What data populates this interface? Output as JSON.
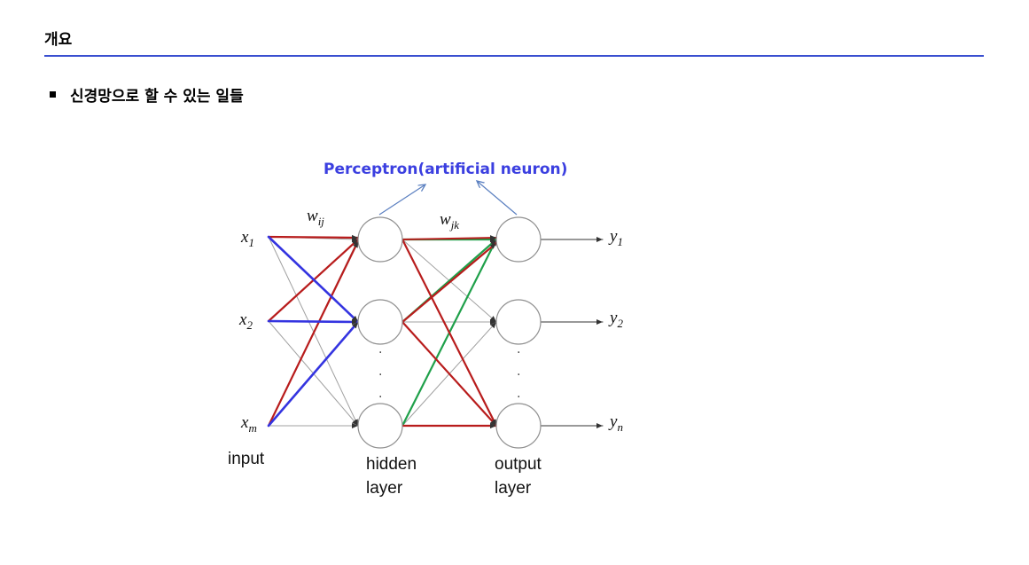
{
  "header": {
    "title": "개요"
  },
  "bullet": {
    "text": "신경망으로 할 수 있는 일들"
  },
  "diagram": {
    "callout": "Perceptron(artificial neuron)",
    "weights": {
      "w_ij": {
        "base": "w",
        "sub": "ij"
      },
      "w_jk": {
        "base": "w",
        "sub": "jk"
      }
    },
    "inputs": [
      {
        "base": "x",
        "sub": "1"
      },
      {
        "base": "x",
        "sub": "2"
      },
      {
        "base": "x",
        "sub": "m"
      }
    ],
    "outputs": [
      {
        "base": "y",
        "sub": "1"
      },
      {
        "base": "y",
        "sub": "2"
      },
      {
        "base": "y",
        "sub": "n"
      }
    ],
    "labels": {
      "input": "input",
      "hidden_line1": "hidden",
      "hidden_line2": "layer",
      "output_line1": "output",
      "output_line2": "layer"
    },
    "ellipsis_dot": ".",
    "colors": {
      "red": "#b81c1c",
      "blue": "#3434e0",
      "green": "#1fa04a",
      "gray": "#a0a0a0",
      "dark": "#333333",
      "callout_arrow": "#5a7fc0",
      "accent_title": "#3b3fe0",
      "rule": "#3a4fd0"
    }
  }
}
